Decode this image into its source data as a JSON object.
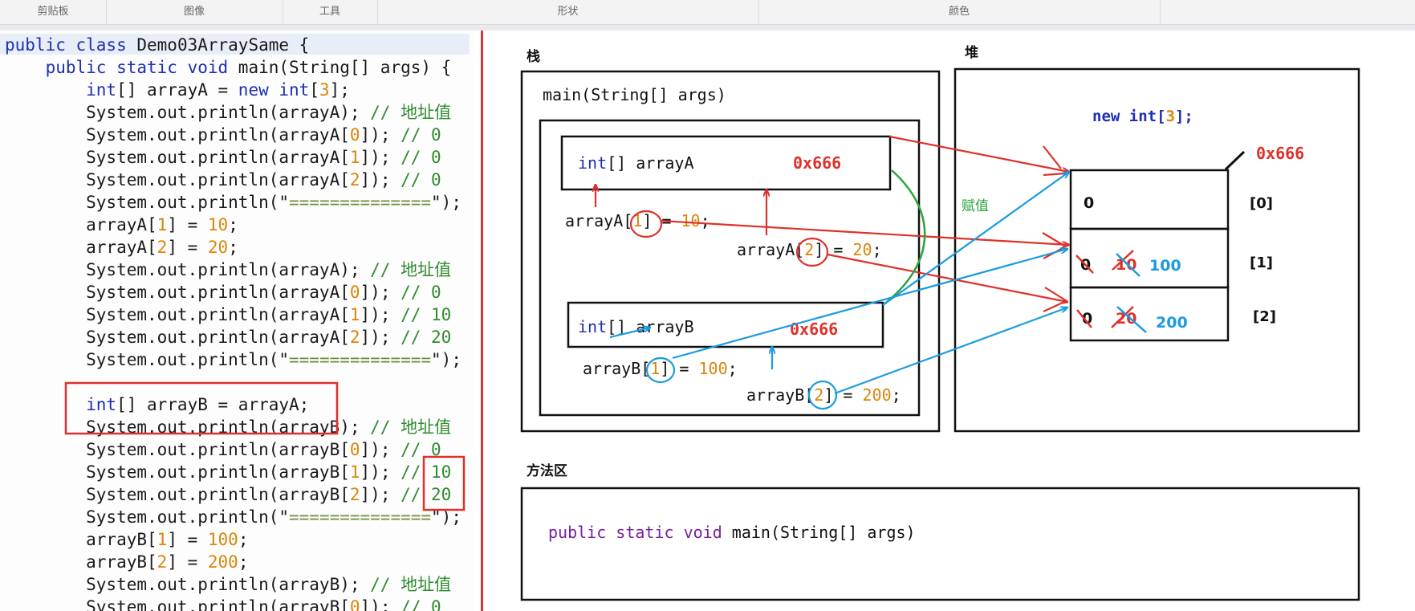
{
  "ribbon": {
    "groups": [
      "剪贴板",
      "图像",
      "工具",
      "形状",
      "颜色"
    ]
  },
  "code": {
    "lines": [
      [
        {
          "t": "public class ",
          "c": "kw"
        },
        {
          "t": "Demo03ArraySame {",
          "c": ""
        }
      ],
      [
        {
          "t": "    public static void ",
          "c": "kw"
        },
        {
          "t": "main(String[] args) {",
          "c": ""
        }
      ],
      [
        {
          "t": "        int",
          "c": "kw"
        },
        {
          "t": "[] arrayA = ",
          "c": ""
        },
        {
          "t": "new int",
          "c": "kw"
        },
        {
          "t": "[",
          "c": ""
        },
        {
          "t": "3",
          "c": "num"
        },
        {
          "t": "];",
          "c": ""
        }
      ],
      [
        {
          "t": "        System.out.println(arrayA); ",
          "c": ""
        },
        {
          "t": "// 地址值",
          "c": "cm"
        }
      ],
      [
        {
          "t": "        System.out.println(arrayA[",
          "c": ""
        },
        {
          "t": "0",
          "c": "num"
        },
        {
          "t": "]); ",
          "c": ""
        },
        {
          "t": "// 0",
          "c": "cm"
        }
      ],
      [
        {
          "t": "        System.out.println(arrayA[",
          "c": ""
        },
        {
          "t": "1",
          "c": "num"
        },
        {
          "t": "]); ",
          "c": ""
        },
        {
          "t": "// 0",
          "c": "cm"
        }
      ],
      [
        {
          "t": "        System.out.println(arrayA[",
          "c": ""
        },
        {
          "t": "2",
          "c": "num"
        },
        {
          "t": "]); ",
          "c": ""
        },
        {
          "t": "// 0",
          "c": "cm"
        }
      ],
      [
        {
          "t": "        System.out.println(\"",
          "c": ""
        },
        {
          "t": "==============",
          "c": "str"
        },
        {
          "t": "\");",
          "c": ""
        }
      ],
      [
        {
          "t": "        arrayA[",
          "c": ""
        },
        {
          "t": "1",
          "c": "num"
        },
        {
          "t": "] = ",
          "c": ""
        },
        {
          "t": "10",
          "c": "num"
        },
        {
          "t": ";",
          "c": ""
        }
      ],
      [
        {
          "t": "        arrayA[",
          "c": ""
        },
        {
          "t": "2",
          "c": "num"
        },
        {
          "t": "] = ",
          "c": ""
        },
        {
          "t": "20",
          "c": "num"
        },
        {
          "t": ";",
          "c": ""
        }
      ],
      [
        {
          "t": "        System.out.println(arrayA); ",
          "c": ""
        },
        {
          "t": "// 地址值",
          "c": "cm"
        }
      ],
      [
        {
          "t": "        System.out.println(arrayA[",
          "c": ""
        },
        {
          "t": "0",
          "c": "num"
        },
        {
          "t": "]); ",
          "c": ""
        },
        {
          "t": "// 0",
          "c": "cm"
        }
      ],
      [
        {
          "t": "        System.out.println(arrayA[",
          "c": ""
        },
        {
          "t": "1",
          "c": "num"
        },
        {
          "t": "]); ",
          "c": ""
        },
        {
          "t": "// 10",
          "c": "cm"
        }
      ],
      [
        {
          "t": "        System.out.println(arrayA[",
          "c": ""
        },
        {
          "t": "2",
          "c": "num"
        },
        {
          "t": "]); ",
          "c": ""
        },
        {
          "t": "// 20",
          "c": "cm"
        }
      ],
      [
        {
          "t": "        System.out.println(\"",
          "c": ""
        },
        {
          "t": "==============",
          "c": "str"
        },
        {
          "t": "\");",
          "c": ""
        }
      ],
      [],
      [
        {
          "t": "        int",
          "c": "kw"
        },
        {
          "t": "[] arrayB = arrayA;",
          "c": ""
        }
      ],
      [
        {
          "t": "        System.out.println(arrayB); ",
          "c": ""
        },
        {
          "t": "// 地址值",
          "c": "cm"
        }
      ],
      [
        {
          "t": "        System.out.println(arrayB[",
          "c": ""
        },
        {
          "t": "0",
          "c": "num"
        },
        {
          "t": "]); ",
          "c": ""
        },
        {
          "t": "// 0",
          "c": "cm"
        }
      ],
      [
        {
          "t": "        System.out.println(arrayB[",
          "c": ""
        },
        {
          "t": "1",
          "c": "num"
        },
        {
          "t": "]); ",
          "c": ""
        },
        {
          "t": "// 10",
          "c": "cm"
        }
      ],
      [
        {
          "t": "        System.out.println(arrayB[",
          "c": ""
        },
        {
          "t": "2",
          "c": "num"
        },
        {
          "t": "]); ",
          "c": ""
        },
        {
          "t": "// 20",
          "c": "cm"
        }
      ],
      [
        {
          "t": "        System.out.println(\"",
          "c": ""
        },
        {
          "t": "==============",
          "c": "str"
        },
        {
          "t": "\");",
          "c": ""
        }
      ],
      [
        {
          "t": "        arrayB[",
          "c": ""
        },
        {
          "t": "1",
          "c": "num"
        },
        {
          "t": "] = ",
          "c": ""
        },
        {
          "t": "100",
          "c": "num"
        },
        {
          "t": ";",
          "c": ""
        }
      ],
      [
        {
          "t": "        arrayB[",
          "c": ""
        },
        {
          "t": "2",
          "c": "num"
        },
        {
          "t": "] = ",
          "c": ""
        },
        {
          "t": "200",
          "c": "num"
        },
        {
          "t": ";",
          "c": ""
        }
      ],
      [
        {
          "t": "        System.out.println(arrayB); ",
          "c": ""
        },
        {
          "t": "// 地址值",
          "c": "cm"
        }
      ],
      [
        {
          "t": "        System.out.println(arrayB[",
          "c": ""
        },
        {
          "t": "0",
          "c": "num"
        },
        {
          "t": "]); ",
          "c": ""
        },
        {
          "t": "// 0",
          "c": "cm"
        }
      ]
    ]
  },
  "diagram": {
    "stack_label": "栈",
    "heap_label": "堆",
    "method_area_label": "方法区",
    "frame_label": "main(String[] args)",
    "var_a_type": "int",
    "var_a_name": "[] arrayA",
    "var_a_addr": "0x666",
    "var_b_type": "int",
    "var_b_name": "[] arrayB",
    "var_b_addr": "0x666",
    "assign_a1": {
      "pre": "arrayA[",
      "idx": "1",
      "post": "] = ",
      "val": "10",
      ";": ";"
    },
    "assign_a2": {
      "pre": "arrayA[",
      "idx": "2",
      "post": "] = ",
      "val": "20"
    },
    "assign_b1": {
      "pre": "arrayB[",
      "idx": "1",
      "post": "] = ",
      "val": "100"
    },
    "assign_b2": {
      "pre": "arrayB[",
      "idx": "2",
      "post": "] = ",
      "val": "200"
    },
    "heap_new_kw": "new int",
    "heap_new_rest": "[",
    "heap_new_num": "3",
    "heap_new_end": "];",
    "heap_addr": "0x666",
    "assign_label": "赋值",
    "cells": [
      {
        "orig": "0",
        "old": "",
        "new": "",
        "index": "[0]"
      },
      {
        "orig": "0",
        "old": "10",
        "new": "100",
        "index": "[1]"
      },
      {
        "orig": "0",
        "old": "20",
        "new": "200",
        "index": "[2]"
      }
    ],
    "method_sig_kw": "public static void",
    "method_sig_rest": "main(String[] args)"
  },
  "colors": {
    "keyword": "#1f2fb0",
    "number": "#d9860a",
    "comment": "#2e8a2e",
    "annotation_red": "#e0302a",
    "annotation_blue": "#1a9be0",
    "annotation_green": "#2aa33a"
  }
}
